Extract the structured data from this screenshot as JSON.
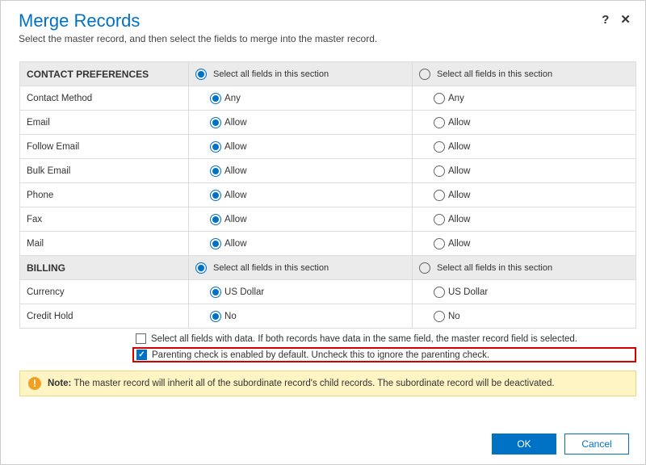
{
  "header": {
    "title": "Merge Records",
    "subtitle": "Select the master record, and then select the fields to merge into the master record."
  },
  "sections": {
    "contact": {
      "title": "CONTACT PREFERENCES",
      "select_all_label": "Select all fields in this section",
      "rows": [
        {
          "label": "Contact Method",
          "value": "Any"
        },
        {
          "label": "Email",
          "value": "Allow"
        },
        {
          "label": "Follow Email",
          "value": "Allow"
        },
        {
          "label": "Bulk Email",
          "value": "Allow"
        },
        {
          "label": "Phone",
          "value": "Allow"
        },
        {
          "label": "Fax",
          "value": "Allow"
        },
        {
          "label": "Mail",
          "value": "Allow"
        }
      ]
    },
    "billing": {
      "title": "BILLING",
      "select_all_label": "Select all fields in this section",
      "rows": [
        {
          "label": "Currency",
          "value": "US Dollar"
        },
        {
          "label": "Credit Hold",
          "value": "No"
        }
      ]
    }
  },
  "checks": {
    "select_all_data": "Select all fields with data. If both records have data in the same field, the master record field is selected.",
    "parenting": "Parenting check is enabled by default. Uncheck this to ignore the parenting check."
  },
  "note": {
    "label": "Note:",
    "text": " The master record will inherit all of the subordinate record's child records. The subordinate record will be deactivated."
  },
  "footer": {
    "ok": "OK",
    "cancel": "Cancel"
  }
}
